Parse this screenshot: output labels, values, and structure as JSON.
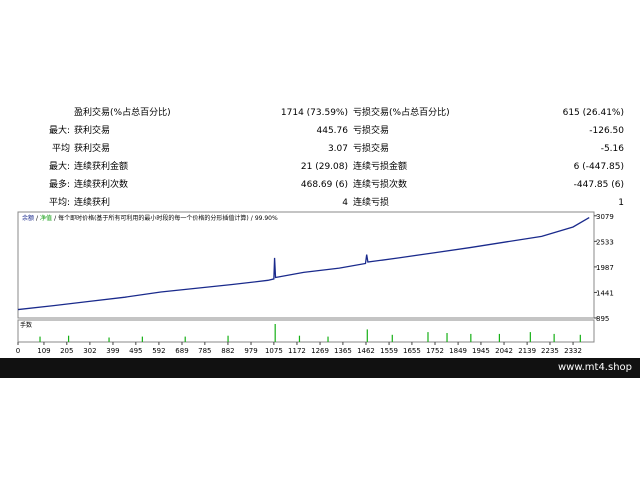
{
  "stats": {
    "rows": [
      {
        "prefix": "",
        "label": "盈利交易(%占总百分比)",
        "value": "1714 (73.59%)",
        "label2": "亏损交易(%占总百分比)",
        "value2": "615 (26.41%)"
      },
      {
        "prefix": "最大:",
        "label": "获利交易",
        "value": "445.76",
        "label2": "亏损交易",
        "value2": "-126.50"
      },
      {
        "prefix": "平均",
        "label": "获利交易",
        "value": "3.07",
        "label2": "亏损交易",
        "value2": "-5.16"
      },
      {
        "prefix": "最大:",
        "label": "连续获利金额",
        "value": "21 (29.08)",
        "label2": "连续亏损金额",
        "value2": "6 (-447.85)"
      },
      {
        "prefix": "最多:",
        "label": "连续获利次数",
        "value": "468.69 (6)",
        "label2": "连续亏损次数",
        "value2": "-447.85 (6)"
      },
      {
        "prefix": "平均:",
        "label": "连续获利",
        "value": "4",
        "label2": "连续亏损",
        "value2": "1"
      }
    ]
  },
  "chart_data": {
    "type": "line",
    "header": {
      "balance": "余额",
      "sep1": "/",
      "equity": "净值",
      "sep2": "/",
      "model": "每个即时价格(基于所有可利用的最小时段的每一个价格的分形插值计算)",
      "sep3": "/",
      "quality": "99.90%"
    },
    "subpanel_label": "手数",
    "x_ticks": [
      0,
      109,
      205,
      302,
      399,
      495,
      592,
      689,
      785,
      882,
      979,
      1075,
      1172,
      1269,
      1365,
      1462,
      1559,
      1655,
      1752,
      1849,
      1945,
      2042,
      2139,
      2235,
      2332
    ],
    "y_ticks": [
      895,
      1441,
      1987,
      2533,
      3079
    ],
    "ylim": [
      895,
      3160
    ],
    "xlim": [
      0,
      2420
    ],
    "series": [
      {
        "values": [
          [
            0,
            1075
          ],
          [
            150,
            1160
          ],
          [
            300,
            1250
          ],
          [
            450,
            1340
          ],
          [
            600,
            1450
          ],
          [
            750,
            1530
          ],
          [
            900,
            1610
          ],
          [
            1050,
            1700
          ],
          [
            1075,
            1730
          ],
          [
            1078,
            2180
          ],
          [
            1082,
            1760
          ],
          [
            1200,
            1870
          ],
          [
            1350,
            1960
          ],
          [
            1460,
            2060
          ],
          [
            1465,
            2250
          ],
          [
            1470,
            2090
          ],
          [
            1600,
            2180
          ],
          [
            1750,
            2290
          ],
          [
            1900,
            2400
          ],
          [
            2050,
            2520
          ],
          [
            2200,
            2640
          ],
          [
            2332,
            2840
          ],
          [
            2400,
            3040
          ]
        ]
      }
    ],
    "volume_bars": [
      [
        90,
        0.3
      ],
      [
        210,
        0.35
      ],
      [
        380,
        0.25
      ],
      [
        520,
        0.3
      ],
      [
        700,
        0.3
      ],
      [
        880,
        0.35
      ],
      [
        1078,
        1.0
      ],
      [
        1180,
        0.35
      ],
      [
        1300,
        0.3
      ],
      [
        1465,
        0.7
      ],
      [
        1570,
        0.4
      ],
      [
        1720,
        0.55
      ],
      [
        1800,
        0.5
      ],
      [
        1900,
        0.45
      ],
      [
        2020,
        0.45
      ],
      [
        2150,
        0.55
      ],
      [
        2250,
        0.45
      ],
      [
        2360,
        0.4
      ]
    ],
    "colors": {
      "balance": "#1a2a8c",
      "equity": "#1a2a8c",
      "volume": "#16b016",
      "header_balance": "#1a2a8c",
      "header_equity": "#0a9a0a"
    }
  },
  "footer": {
    "site": "www.mt4.shop"
  }
}
